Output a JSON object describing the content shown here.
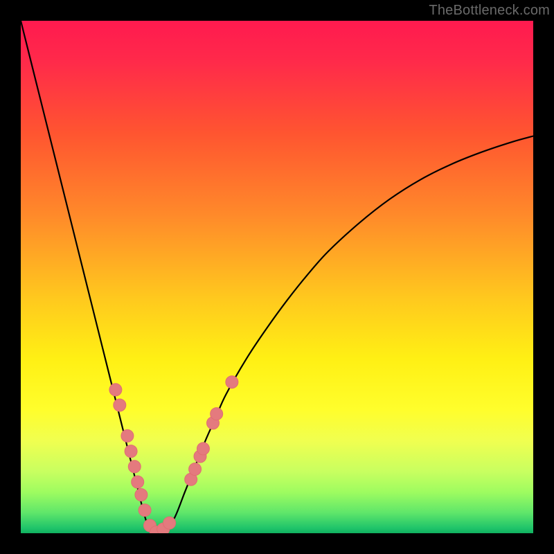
{
  "watermark": {
    "text": "TheBottleneck.com"
  },
  "colors": {
    "curve_stroke": "#000000",
    "marker_fill": "#e47a7e",
    "marker_stroke": "#e06e72"
  },
  "chart_data": {
    "type": "line",
    "title": "",
    "xlabel": "",
    "ylabel": "",
    "xlim": [
      0,
      100
    ],
    "ylim": [
      0,
      100
    ],
    "curve": {
      "x": [
        0,
        2,
        4,
        6,
        8,
        10,
        12,
        14,
        16,
        18,
        19,
        20,
        21,
        22,
        23,
        24,
        25,
        26,
        27,
        28,
        30,
        32,
        34,
        36,
        38,
        40,
        44,
        48,
        52,
        56,
        60,
        66,
        72,
        78,
        84,
        90,
        96,
        100
      ],
      "y": [
        100,
        92,
        84,
        76,
        68,
        60,
        52,
        44,
        36,
        28,
        24,
        20,
        16,
        12,
        8,
        4,
        1,
        0.5,
        0,
        0.5,
        3,
        8,
        13,
        18,
        22.5,
        27,
        34,
        40,
        45.5,
        50.5,
        55,
        60.5,
        65.2,
        69,
        72,
        74.4,
        76.4,
        77.5
      ]
    },
    "markers": [
      {
        "x": 18.5,
        "y": 28.0
      },
      {
        "x": 19.3,
        "y": 25.0
      },
      {
        "x": 20.8,
        "y": 19.0
      },
      {
        "x": 21.5,
        "y": 16.0
      },
      {
        "x": 22.2,
        "y": 13.0
      },
      {
        "x": 22.8,
        "y": 10.0
      },
      {
        "x": 23.5,
        "y": 7.5
      },
      {
        "x": 24.2,
        "y": 4.5
      },
      {
        "x": 25.2,
        "y": 1.5
      },
      {
        "x": 26.4,
        "y": 0.2
      },
      {
        "x": 27.8,
        "y": 0.8
      },
      {
        "x": 29.0,
        "y": 2.0
      },
      {
        "x": 33.2,
        "y": 10.5
      },
      {
        "x": 34.0,
        "y": 12.5
      },
      {
        "x": 35.0,
        "y": 15.0
      },
      {
        "x": 35.6,
        "y": 16.5
      },
      {
        "x": 37.5,
        "y": 21.5
      },
      {
        "x": 38.2,
        "y": 23.3
      },
      {
        "x": 41.2,
        "y": 29.5
      }
    ]
  }
}
